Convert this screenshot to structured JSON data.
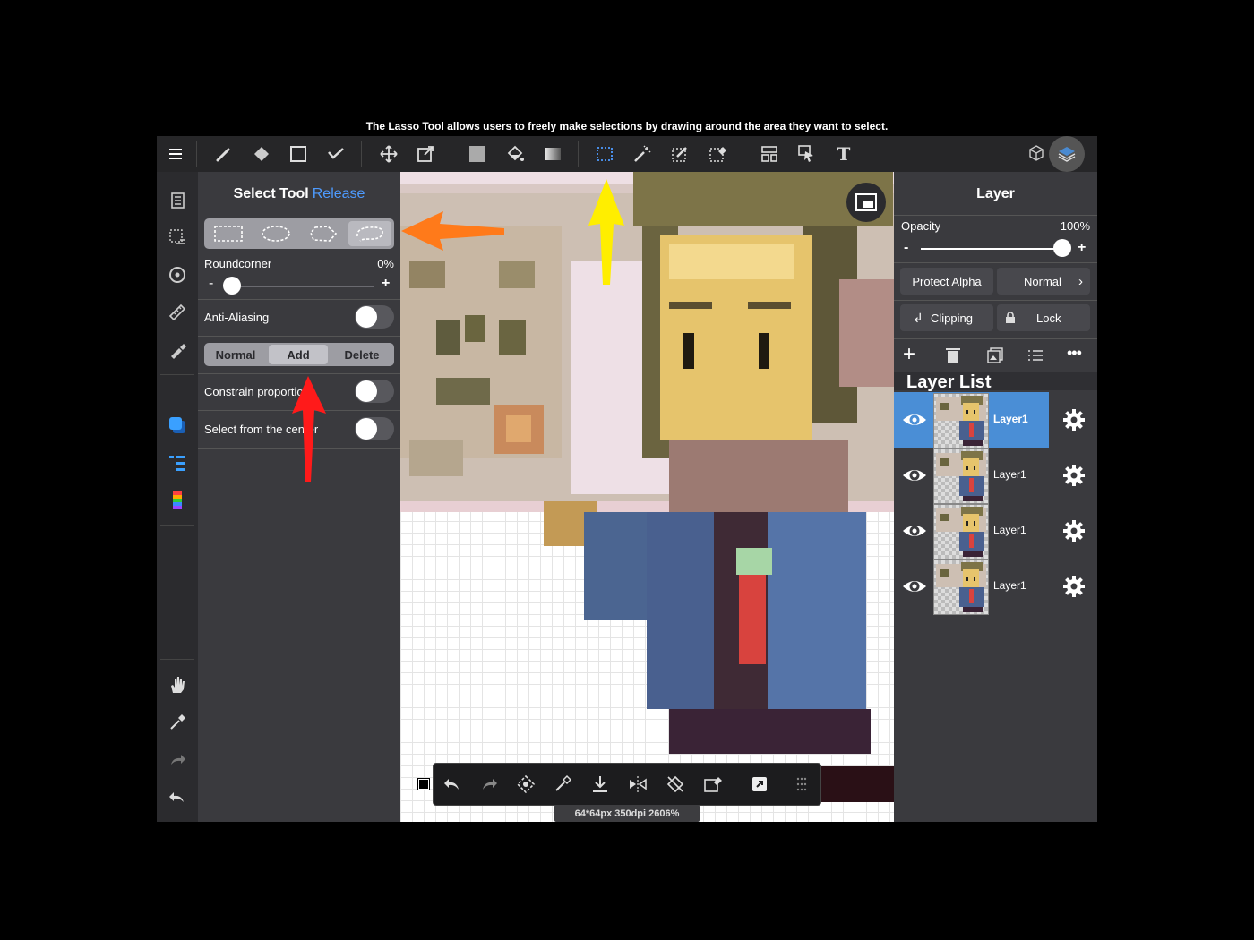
{
  "caption": "The Lasso Tool allows users to freely make selections by drawing around the area they want to select.",
  "toolbar": {
    "icons": [
      "menu-icon",
      "brush-icon",
      "eraser-icon",
      "rectangle-icon",
      "check-icon",
      "move-icon",
      "transform-icon",
      "fill-color-icon",
      "bucket-icon",
      "gradient-icon",
      "select-rect-icon",
      "magic-wand-icon",
      "select-pen-icon",
      "select-eraser-icon",
      "filter-icon",
      "pointer-icon",
      "text-icon",
      "material-icon",
      "layers-icon"
    ],
    "text_tool_glyph": "T"
  },
  "select_panel": {
    "title": "Select Tool",
    "release_label": "Release",
    "shapes": [
      "rectangle",
      "ellipse",
      "polygon",
      "lasso"
    ],
    "selected_shape": "lasso",
    "roundcorner_label": "Roundcorner",
    "roundcorner_value": "0%",
    "minus": "-",
    "plus": "+",
    "anti_aliasing_label": "Anti-Aliasing",
    "mode": {
      "options": [
        "Normal",
        "Add",
        "Delete"
      ],
      "selected": "Add"
    },
    "constrain_label": "Constrain proportions",
    "from_center_label": "Select from the center"
  },
  "layer_panel": {
    "title": "Layer",
    "opacity_label": "Opacity",
    "opacity_value": "100%",
    "minus": "-",
    "plus": "+",
    "protect_alpha": "Protect Alpha",
    "blend_mode": "Normal",
    "clipping": "Clipping",
    "lock": "Lock",
    "list_title": "Layer List",
    "layers": [
      {
        "name": "Layer1",
        "selected": true
      },
      {
        "name": "Layer1",
        "selected": false
      },
      {
        "name": "Layer1",
        "selected": false
      },
      {
        "name": "Layer1",
        "selected": false
      }
    ]
  },
  "status_text": "64*64px 350dpi 2606%",
  "annotation_colors": {
    "orange": "#ff7a1a",
    "yellow": "#ffee00",
    "red": "#ff1a1a"
  },
  "accent": "#4e9bff"
}
